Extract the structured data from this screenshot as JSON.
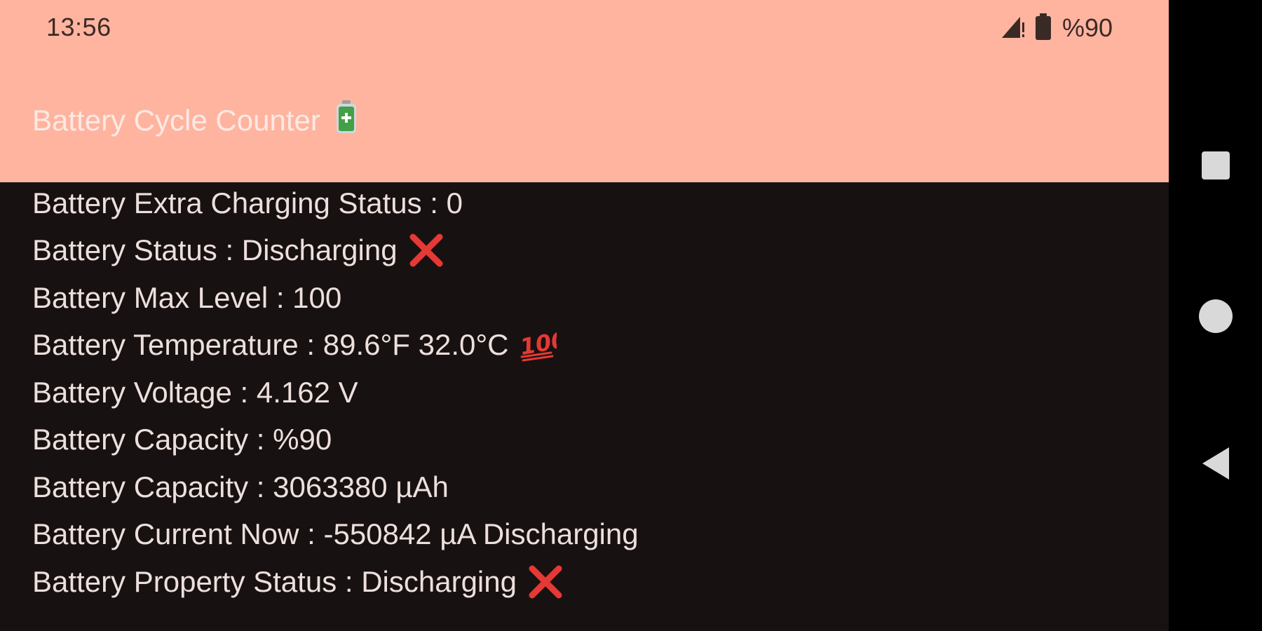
{
  "status_bar": {
    "time": "13:56",
    "battery_percent": "%90",
    "icons": [
      "signal-no-data-icon",
      "battery-icon"
    ]
  },
  "app_bar": {
    "title": "Battery Cycle Counter",
    "title_icon": "battery-icon",
    "background_color": "#ffb4a0",
    "title_color": "#fbe9e4"
  },
  "info": {
    "rows": [
      {
        "text": "Battery Extra Charging Status : 0",
        "emoji": ""
      },
      {
        "text": "Battery Status : Discharging",
        "emoji": "cross-mark-icon"
      },
      {
        "text": "Battery Max Level : 100",
        "emoji": ""
      },
      {
        "text": "Battery Temperature : 89.6°F 32.0°C",
        "emoji": "hundred-points-icon"
      },
      {
        "text": "Battery Voltage : 4.162 V",
        "emoji": ""
      },
      {
        "text": "Battery Capacity : %90",
        "emoji": ""
      },
      {
        "text": "Battery Capacity : 3063380 µAh",
        "emoji": ""
      },
      {
        "text": "Battery Current Now : -550842 µA Discharging",
        "emoji": ""
      },
      {
        "text": "Battery Property Status : Discharging",
        "emoji": "cross-mark-icon"
      }
    ]
  },
  "navigation_bar": {
    "buttons": [
      "recents-icon",
      "home-icon",
      "back-icon"
    ]
  },
  "colors": {
    "background": "#181111",
    "text": "#ecdfdc",
    "accent": "#ffb4a0",
    "cross": "#e53935"
  }
}
